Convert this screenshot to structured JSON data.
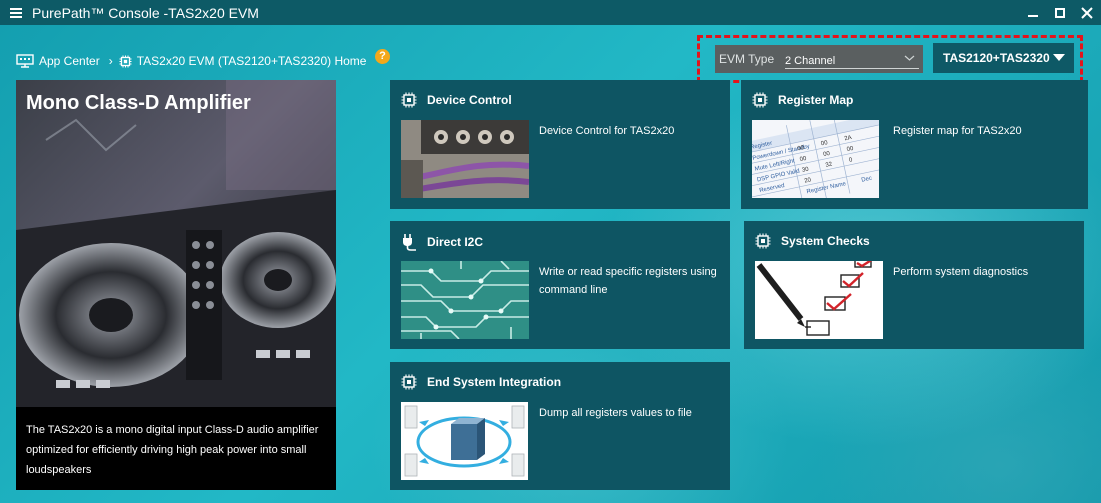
{
  "window": {
    "title": "PurePath™ Console -TAS2x20 EVM"
  },
  "breadcrumb": {
    "app_center": "App Center",
    "separator": "›",
    "current": "TAS2x20 EVM (TAS2120+TAS2320) Home",
    "help": "?"
  },
  "evm": {
    "type_label": "EVM Type",
    "type_value": "2 Channel",
    "model_value": "TAS2120+TAS2320"
  },
  "hero": {
    "title": "Mono Class-D Amplifier",
    "description": "The TAS2x20 is a mono digital input Class-D audio amplifier optimized for efficiently driving high peak power into small loudspeakers"
  },
  "tiles": [
    {
      "id": "device-control",
      "title": "Device Control",
      "description": "Device Control for TAS2x20",
      "icon": "chip-icon"
    },
    {
      "id": "register-map",
      "title": "Register Map",
      "description": "Register map for TAS2x20",
      "icon": "chip-icon"
    },
    {
      "id": "direct-i2c",
      "title": "Direct I2C",
      "description": "Write or read specific registers using command line",
      "icon": "plug-icon"
    },
    {
      "id": "system-checks",
      "title": "System Checks",
      "description": "Perform system diagnostics",
      "icon": "chip-icon"
    },
    {
      "id": "end-system-integration",
      "title": "End System Integration",
      "description": "Dump all registers values to file",
      "icon": "chip-icon"
    }
  ],
  "register_preview": {
    "labels": [
      "Register",
      "Powerdown / Standby",
      "Mute Left/Right",
      "DSP GPIO Valid",
      "Reserved",
      "Register Name",
      "Dec"
    ],
    "values": [
      "00",
      "00",
      "00",
      "00",
      "00",
      "2A",
      "30",
      "32",
      "20",
      "0"
    ]
  },
  "colors": {
    "titlebar": "#0d5a66",
    "tile": "#0e5563",
    "highlight": "#e4141b",
    "help_badge": "#f3a81b"
  }
}
